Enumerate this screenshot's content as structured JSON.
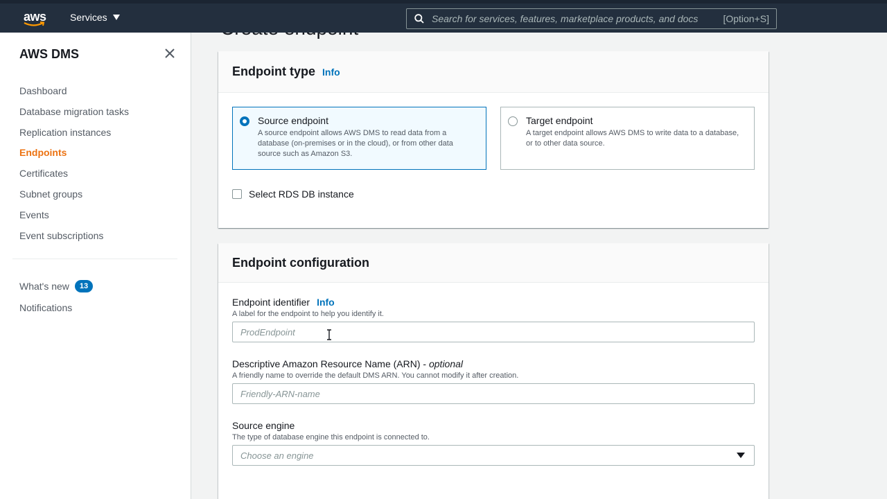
{
  "topnav": {
    "logo_text": "aws",
    "services_label": "Services",
    "search_placeholder": "Search for services, features, marketplace products, and docs",
    "search_shortcut": "[Option+S]"
  },
  "sidebar": {
    "title": "AWS DMS",
    "items": [
      {
        "label": "Dashboard",
        "active": false
      },
      {
        "label": "Database migration tasks",
        "active": false
      },
      {
        "label": "Replication instances",
        "active": false
      },
      {
        "label": "Endpoints",
        "active": true
      },
      {
        "label": "Certificates",
        "active": false
      },
      {
        "label": "Subnet groups",
        "active": false
      },
      {
        "label": "Events",
        "active": false
      },
      {
        "label": "Event subscriptions",
        "active": false
      }
    ],
    "secondary": {
      "whats_new_label": "What's new",
      "whats_new_count": "13",
      "notifications_label": "Notifications"
    }
  },
  "main": {
    "page_title": "Create endpoint",
    "endpoint_type": {
      "title": "Endpoint type",
      "info": "Info",
      "source": {
        "title": "Source endpoint",
        "desc": "A source endpoint allows AWS DMS to read data from a database (on-premises or in the cloud), or from other data source such as Amazon S3.",
        "selected": true
      },
      "target": {
        "title": "Target endpoint",
        "desc": "A target endpoint allows AWS DMS to write data to a database, or to other data source.",
        "selected": false
      },
      "rds_checkbox_label": "Select RDS DB instance"
    },
    "endpoint_config": {
      "title": "Endpoint configuration",
      "identifier": {
        "label": "Endpoint identifier",
        "info": "Info",
        "desc": "A label for the endpoint to help you identify it.",
        "placeholder": "ProdEndpoint",
        "value": ""
      },
      "arn": {
        "label": "Descriptive Amazon Resource Name (ARN) - ",
        "optional": "optional",
        "desc": "A friendly name to override the default DMS ARN. You cannot modify it after creation.",
        "placeholder": "Friendly-ARN-name",
        "value": ""
      },
      "source_engine": {
        "label": "Source engine",
        "desc": "The type of database engine this endpoint is connected to.",
        "selected": "Choose an engine"
      }
    }
  },
  "colors": {
    "nav_bg": "#232f3e",
    "accent_orange": "#ec7211",
    "link_blue": "#0073bb"
  }
}
